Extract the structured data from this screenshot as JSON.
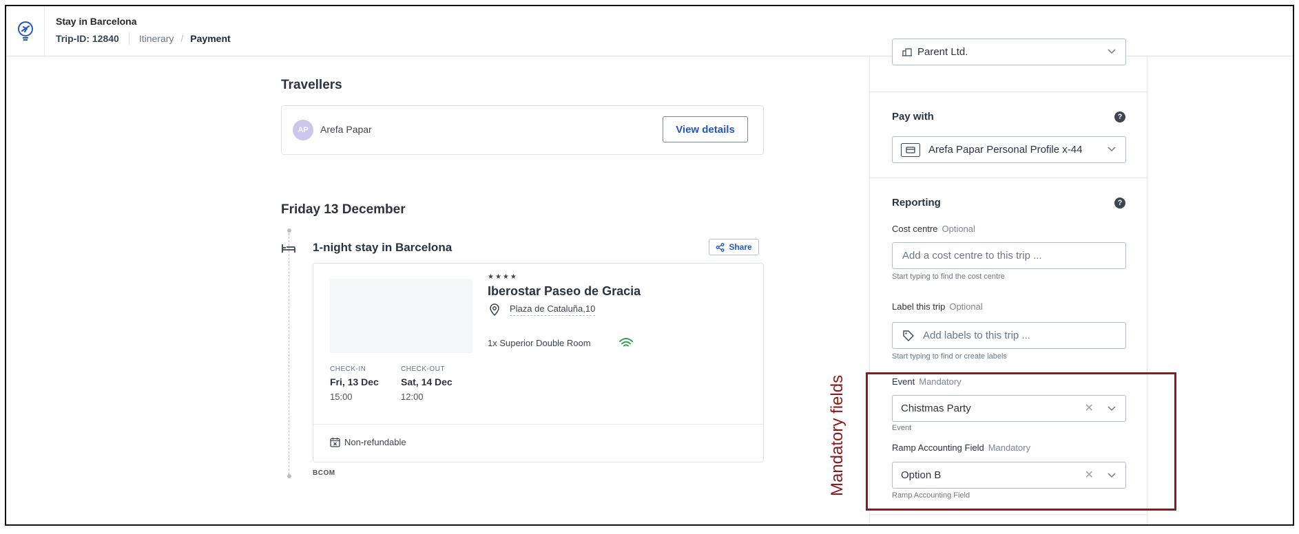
{
  "header": {
    "title": "Stay in Barcelona",
    "trip_id": "Trip-ID: 12840",
    "breadcrumb": {
      "itinerary": "Itinerary",
      "separator": "/",
      "current": "Payment"
    }
  },
  "travellers": {
    "title": "Travellers",
    "traveller": {
      "initials": "AP",
      "name": "Arefa Papar"
    },
    "view_details": "View details"
  },
  "day": {
    "title": "Friday 13 December",
    "stay_title": "1-night stay in Barcelona",
    "share": "Share",
    "hotel": {
      "stars": "★★★★",
      "name": "Iberostar Paseo de Gracia",
      "address": "Plaza de Cataluña,10",
      "room": "1x Superior Double Room",
      "checkin_label": "CHECK-IN",
      "checkin_date": "Fri, 13 Dec",
      "checkin_time": "15:00",
      "checkout_label": "CHECK-OUT",
      "checkout_date": "Sat, 14 Dec",
      "checkout_time": "12:00",
      "refund": "Non-refundable"
    },
    "provider": "BCOM"
  },
  "panel": {
    "company_select": "Parent Ltd.",
    "pay_with": {
      "title": "Pay with",
      "value": "Arefa Papar Personal Profile x-44"
    },
    "reporting": {
      "title": "Reporting",
      "cost_centre": {
        "label": "Cost centre",
        "tag": "Optional",
        "placeholder": "Add a cost centre to this trip ...",
        "hint": "Start typing to find the cost centre"
      },
      "label_trip": {
        "label": "Label this trip",
        "tag": "Optional",
        "placeholder": "Add labels to this trip ...",
        "hint": "Start typing to find or create labels"
      },
      "event": {
        "label": "Event",
        "tag": "Mandatory",
        "value": "Chistmas Party",
        "hint": "Event"
      },
      "ramp": {
        "label": "Ramp Accounting Field",
        "tag": "Mandatory",
        "value": "Option B",
        "hint": "Ramp Accounting Field"
      }
    }
  },
  "annotation": {
    "text": "Mandatory fields",
    "color": "#8b1a1a"
  },
  "colors": {
    "accent": "#2456c4",
    "wifi": "#2e9e4f",
    "avatar": "#cbc6ec"
  }
}
